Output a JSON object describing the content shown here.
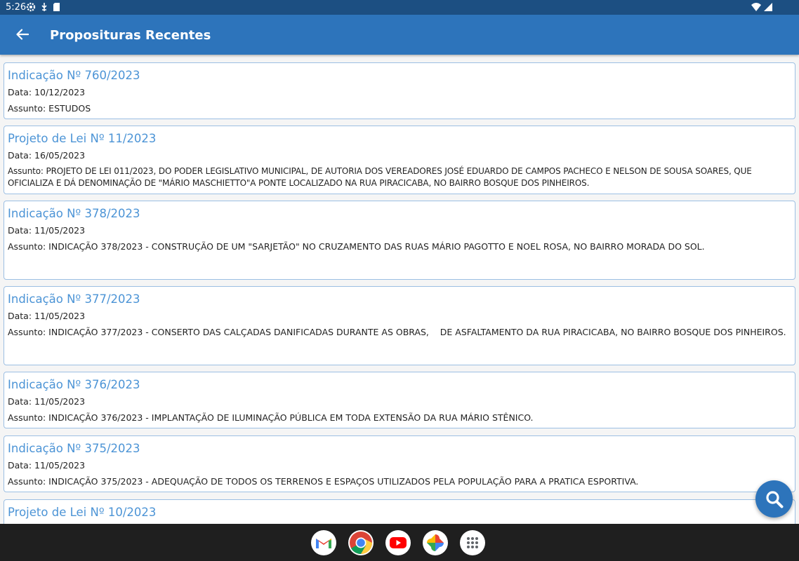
{
  "status_bar": {
    "time": "5:26"
  },
  "app_bar": {
    "title": "Proposituras Recentes"
  },
  "labels": {
    "data": "Data:",
    "assunto": "Assunto:"
  },
  "items": [
    {
      "title": "Indicação Nº 760/2023",
      "date": "10/12/2023",
      "subject": "ESTUDOS"
    },
    {
      "title": "Projeto de Lei Nº 11/2023",
      "date": "16/05/2023",
      "subject": "PROJETO DE LEI 011/2023, DO PODER LEGISLATIVO MUNICIPAL, DE AUTORIA DOS VEREADORES JOSÉ EDUARDO DE CAMPOS PACHECO E NELSON DE SOUSA SOARES, QUE OFICIALIZA E DÁ DENOMINAÇÃO DE \"MÁRIO MASCHIETTO\"A PONTE LOCALIZADO NA RUA PIRACICABA, NO BAIRRO BOSQUE DOS PINHEIROS."
    },
    {
      "title": "Indicação Nº 378/2023",
      "date": "11/05/2023",
      "subject": "INDICAÇÃO 378/2023 - CONSTRUÇÃO DE UM \"SARJETÃO\" NO CRUZAMENTO DAS RUAS MÁRIO PAGOTTO E NOEL ROSA, NO BAIRRO MORADA DO SOL."
    },
    {
      "title": "Indicação Nº 377/2023",
      "date": "11/05/2023",
      "subject": "INDICAÇÃO 377/2023 - CONSERTO DAS CALÇADAS DANIFICADAS DURANTE AS OBRAS,    DE ASFALTAMENTO DA RUA PIRACICABA, NO BAIRRO BOSQUE DOS PINHEIROS."
    },
    {
      "title": "Indicação Nº 376/2023",
      "date": "11/05/2023",
      "subject": "INDICAÇÃO 376/2023 - IMPLANTAÇÃO DE ILUMINAÇÃO PÚBLICA EM TODA EXTENSÃO DA RUA MÁRIO STÊNICO."
    },
    {
      "title": "Indicação Nº 375/2023",
      "date": "11/05/2023",
      "subject": "INDICAÇÃO 375/2023 - ADEQUAÇÃO DE TODOS OS TERRENOS E ESPAÇOS UTILIZADOS PELA POPULAÇÃO PARA A PRATICA ESPORTIVA."
    },
    {
      "title": "Projeto de Lei Nº 10/2023",
      "date": "",
      "subject": ""
    }
  ],
  "dock": [
    "gmail-icon",
    "chrome-icon",
    "youtube-icon",
    "photos-icon",
    "app-drawer-icon"
  ],
  "colors": {
    "status_bar": "#1c4f82",
    "app_bar": "#2d74bb",
    "card_title": "#4c94d6",
    "card_border": "#9cbfe3",
    "nav_bar": "#1f1f1f"
  }
}
